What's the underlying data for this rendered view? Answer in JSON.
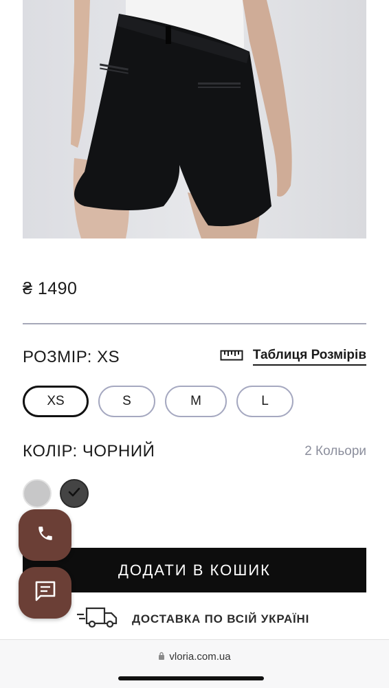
{
  "product": {
    "price": "₴ 1490",
    "size_label": "РОЗМІР: XS",
    "size_table_label": "Таблиця Розмірів",
    "sizes": [
      {
        "label": "XS",
        "selected": true
      },
      {
        "label": "S",
        "selected": false
      },
      {
        "label": "M",
        "selected": false
      },
      {
        "label": "L",
        "selected": false
      }
    ],
    "color_label": "КОЛІР: ЧОРНИЙ",
    "color_count": "2 Кольори",
    "colors": [
      {
        "hex": "#c7c7c8",
        "selected": false
      },
      {
        "hex": "#444444",
        "selected": true
      }
    ],
    "add_to_cart_label": "ДОДАТИ В КОШИК",
    "delivery_text": "ДОСТАВКА ПО ВСІЙ УКРАЇНІ"
  },
  "floating": {
    "call_icon": "phone-icon",
    "chat_icon": "chat-icon",
    "color": "#6b3f36"
  },
  "browser": {
    "url": "vloria.com.ua"
  },
  "icons": {
    "ruler": "ruler-icon",
    "truck": "delivery-truck-icon",
    "lock": "lock-icon",
    "check": "check-icon"
  }
}
